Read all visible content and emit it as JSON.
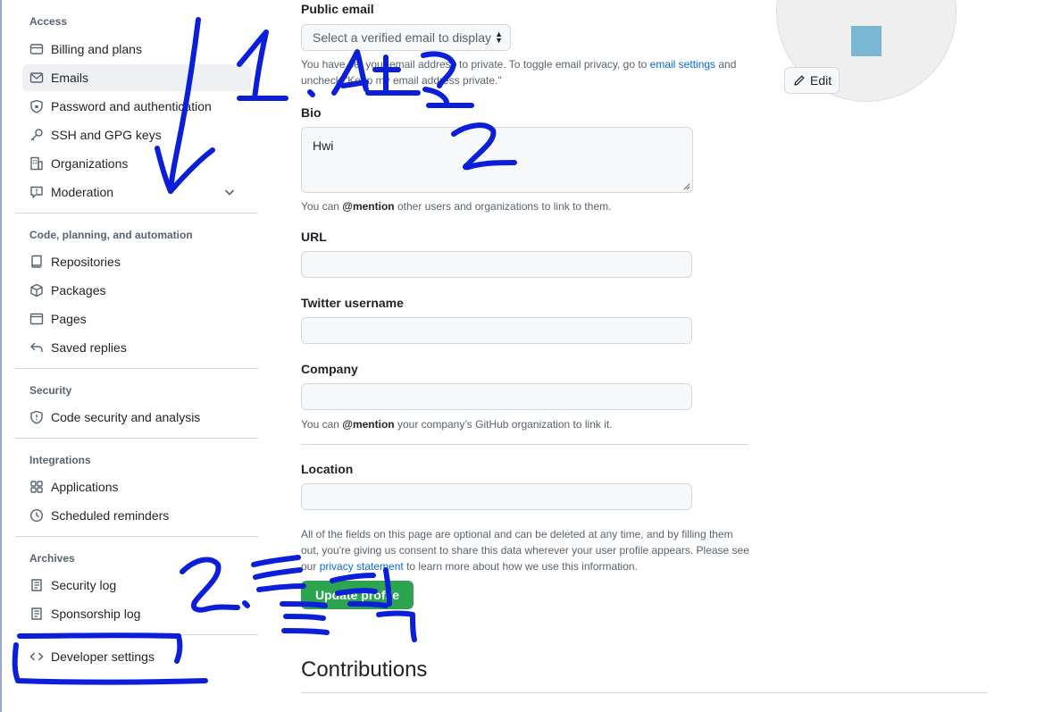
{
  "sidebar": {
    "sections": [
      {
        "title": "Access"
      },
      {
        "title": "Code, planning, and automation"
      },
      {
        "title": "Security"
      },
      {
        "title": "Integrations"
      },
      {
        "title": "Archives"
      }
    ],
    "items": {
      "billing": {
        "label": "Billing and plans",
        "icon": "credit-card-icon"
      },
      "emails": {
        "label": "Emails",
        "icon": "mail-icon",
        "selected": true
      },
      "password": {
        "label": "Password and authentication",
        "icon": "shield-lock-icon"
      },
      "ssh": {
        "label": "SSH and GPG keys",
        "icon": "key-icon"
      },
      "orgs": {
        "label": "Organizations",
        "icon": "organization-icon"
      },
      "moderation": {
        "label": "Moderation",
        "icon": "report-icon"
      },
      "repos": {
        "label": "Repositories",
        "icon": "repo-icon"
      },
      "packages": {
        "label": "Packages",
        "icon": "package-icon"
      },
      "pages": {
        "label": "Pages",
        "icon": "browser-icon"
      },
      "saved": {
        "label": "Saved replies",
        "icon": "reply-icon"
      },
      "codesec": {
        "label": "Code security and analysis",
        "icon": "shield-icon"
      },
      "apps": {
        "label": "Applications",
        "icon": "apps-icon"
      },
      "reminders": {
        "label": "Scheduled reminders",
        "icon": "clock-icon"
      },
      "seclog": {
        "label": "Security log",
        "icon": "log-icon"
      },
      "sponslog": {
        "label": "Sponsorship log",
        "icon": "log-icon"
      },
      "dev": {
        "label": "Developer settings",
        "icon": "code-icon"
      }
    }
  },
  "form": {
    "public_email": {
      "label": "Public email",
      "select_value": "Select a verified email to display",
      "note_a": "You have set your email address to private. To toggle email privacy, go to ",
      "note_link": "email settings",
      "note_b": " and",
      "note_c": "uncheck \"Keep my email address private.\""
    },
    "bio": {
      "label": "Bio",
      "value": "Hwi",
      "note_a": "You can ",
      "note_b": "@mention",
      "note_c": " other users and organizations to link to them."
    },
    "url": {
      "label": "URL",
      "value": ""
    },
    "twitter": {
      "label": "Twitter username",
      "value": ""
    },
    "company": {
      "label": "Company",
      "value": "",
      "note_a": "You can ",
      "note_b": "@mention",
      "note_c": " your company’s GitHub organization to link it."
    },
    "location": {
      "label": "Location",
      "value": ""
    },
    "disclaimer": {
      "line1": "All of the fields on this page are optional and can be deleted at any time, and by filling them",
      "line2": "out, you're giving us consent to share this data wherever your user profile appears. Please see",
      "line3_a": "our ",
      "line3_link": "privacy statement",
      "line3_b": " to learn more about how we use this information."
    },
    "update_button": "Update profile"
  },
  "contributions": {
    "title": "Contributions"
  },
  "avatar": {
    "edit_label": "Edit",
    "color": "#7ab7d4"
  },
  "annotations": {
    "color": "#0b1fd8"
  }
}
